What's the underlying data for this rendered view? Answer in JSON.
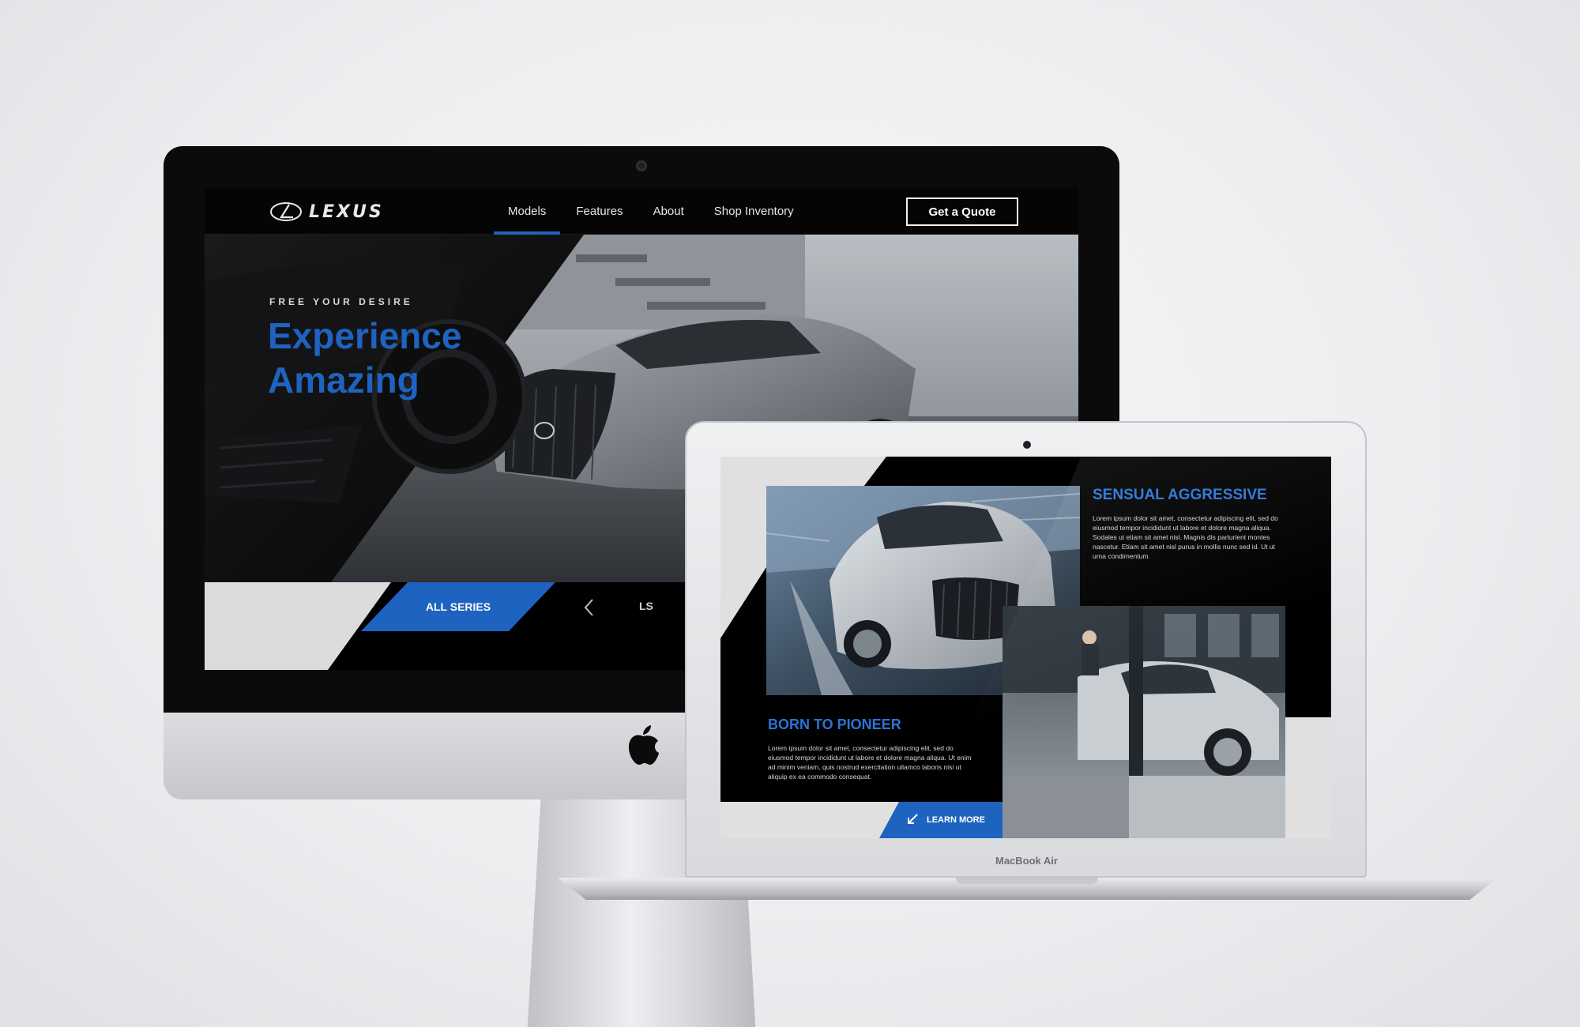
{
  "imac": {
    "brand": "LEXUS",
    "nav": {
      "links": [
        {
          "label": "Models",
          "active": true
        },
        {
          "label": "Features",
          "active": false
        },
        {
          "label": "About",
          "active": false
        },
        {
          "label": "Shop Inventory",
          "active": false
        }
      ],
      "cta_label": "Get a Quote"
    },
    "hero": {
      "eyebrow": "FREE YOUR DESIRE",
      "headline_line1": "Experience",
      "headline_line2": "Amazing",
      "series_button": "ALL SERIES",
      "series_item": "LS"
    }
  },
  "macbook": {
    "device_label": "MacBook Air",
    "section1": {
      "heading": "SENSUAL AGGRESSIVE",
      "body": "Lorem ipsum dolor sit amet, consectetur adipiscing elit, sed do eiusmod tempor incididunt ut labore et dolore magna aliqua. Sodales ut etiam sit amet nisl. Magnis dis parturient montes nascetur. Etiam sit amet nisl purus in mollis nunc sed id. Ut ut urna condimentum."
    },
    "section2": {
      "heading": "BORN TO PIONEER",
      "body": "Lorem ipsum dolor sit amet, consectetur adipiscing elit, sed do eiusmod tempor incididunt ut labore et dolore magna aliqua. Ut enim ad minim veniam, quis nostrud exercitation ullamco laboris nisi ut aliquip ex ea commodo consequat.",
      "button_label": "LEARN MORE"
    }
  },
  "colors": {
    "accent": "#1e63c0",
    "heading_blue": "#2a74d8",
    "dark": "#050505",
    "light_panel": "#e0e0e0"
  },
  "icons": [
    "lexus-logo-icon",
    "apple-logo-icon",
    "chevron-left-icon",
    "arrow-down-left-icon",
    "camera-icon"
  ]
}
